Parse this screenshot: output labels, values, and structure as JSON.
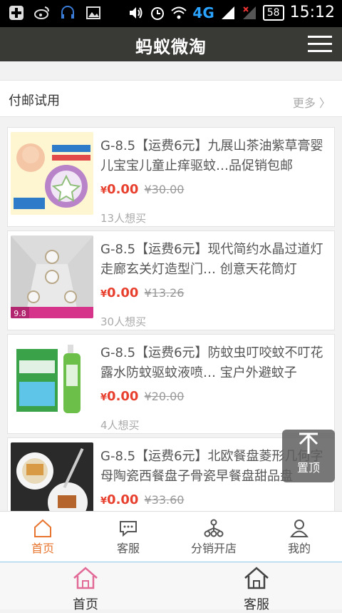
{
  "status_bar": {
    "signal_4g": "4G",
    "battery": "58",
    "time": "15:12"
  },
  "header": {
    "title": "蚂蚁微淘"
  },
  "section": {
    "title": "付邮试用",
    "more": "更多 〉"
  },
  "products": [
    {
      "name": "G-8.5【运费6元】九展山茶油紫草膏婴儿宝宝儿童止痒驱蚊…品促销包邮",
      "price_symbol": "¥",
      "price": "0.00",
      "old_price": "¥30.00",
      "wants": "13人想买",
      "thumb_text": ""
    },
    {
      "name": "G-8.5【运费6元】现代简约水晶过道灯走廊玄关灯造型门… 创意天花筒灯",
      "price_symbol": "¥",
      "price": "0.00",
      "old_price": "¥13.26",
      "wants": "30人想买",
      "thumb_text": "9.8"
    },
    {
      "name": "G-8.5【运费6元】防蚊虫叮咬蚊不叮花露水防蚊驱蚊液喷… 宝户外避蚊子",
      "price_symbol": "¥",
      "price": "0.00",
      "old_price": "¥20.00",
      "wants": "4人想买",
      "thumb_text": ""
    },
    {
      "name": "G-8.5【运费6元】北欧餐盘菱形几何字母陶瓷西餐盘子骨瓷早餐盘甜品盘",
      "price_symbol": "¥",
      "price": "0.00",
      "old_price": "¥33.60",
      "wants": "",
      "thumb_text": ""
    }
  ],
  "to_top": {
    "label": "置顶"
  },
  "tabs": [
    {
      "label": "首页",
      "icon": "home-icon",
      "active": true
    },
    {
      "label": "客服",
      "icon": "chat-icon",
      "active": false
    },
    {
      "label": "分销开店",
      "icon": "network-icon",
      "active": false
    },
    {
      "label": "我的",
      "icon": "user-icon",
      "active": false
    }
  ],
  "bottom_tabs": [
    {
      "label": "首页",
      "icon": "home-icon"
    },
    {
      "label": "客服",
      "icon": "home-icon"
    }
  ],
  "colors": {
    "accent": "#e8752f",
    "price": "#e8402e",
    "header": "#393a35",
    "bottom_home": "#e26a97"
  }
}
